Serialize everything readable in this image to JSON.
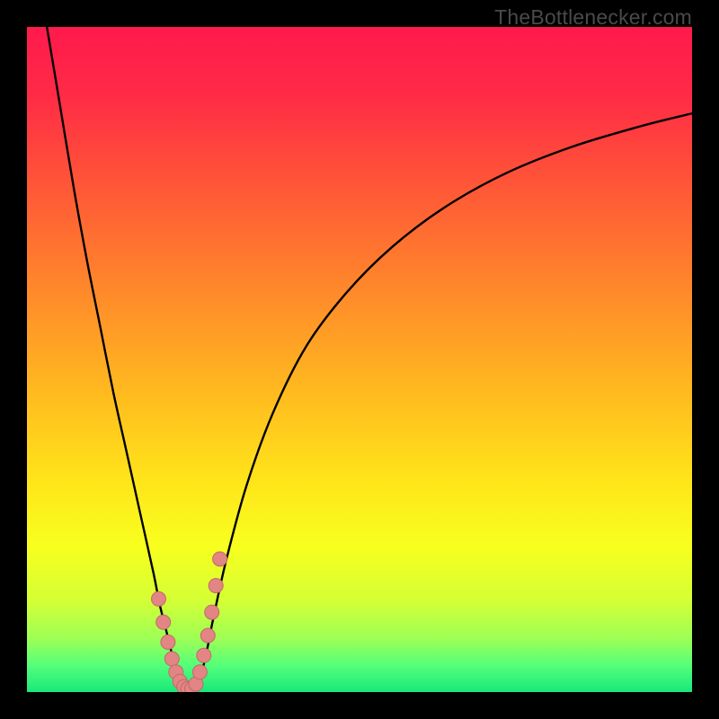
{
  "watermark": "TheBottlenecker.com",
  "gradient": {
    "stops": [
      {
        "offset": 0.0,
        "color": "#ff1a4d"
      },
      {
        "offset": 0.1,
        "color": "#ff2a46"
      },
      {
        "offset": 0.25,
        "color": "#ff5a36"
      },
      {
        "offset": 0.4,
        "color": "#ff8a2a"
      },
      {
        "offset": 0.55,
        "color": "#ffba1f"
      },
      {
        "offset": 0.68,
        "color": "#ffe41a"
      },
      {
        "offset": 0.78,
        "color": "#f8ff1e"
      },
      {
        "offset": 0.86,
        "color": "#d6ff34"
      },
      {
        "offset": 0.92,
        "color": "#9dff55"
      },
      {
        "offset": 0.96,
        "color": "#55ff7a"
      },
      {
        "offset": 1.0,
        "color": "#18e87a"
      }
    ]
  },
  "colors": {
    "curve_stroke": "#000000",
    "marker_fill": "#e38584",
    "marker_stroke": "#c06a69",
    "frame": "#000000"
  },
  "chart_data": {
    "type": "line",
    "title": "",
    "xlabel": "",
    "ylabel": "",
    "xlim": [
      0,
      100
    ],
    "ylim": [
      0,
      100
    ],
    "series": [
      {
        "name": "bottleneck-curve",
        "x": [
          3,
          5,
          7,
          9,
          11,
          13,
          15,
          17,
          19,
          20,
          21,
          22,
          23,
          24,
          25,
          26,
          27,
          28,
          30,
          33,
          37,
          42,
          48,
          55,
          63,
          72,
          82,
          92,
          100
        ],
        "y": [
          100,
          88,
          76,
          65,
          55,
          45,
          36,
          27,
          18,
          13,
          9,
          5,
          2,
          0.5,
          0.5,
          2,
          6,
          11,
          20,
          31,
          42,
          52,
          60,
          67,
          73,
          78,
          82,
          85,
          87
        ]
      }
    ],
    "markers": {
      "name": "highlighted-points",
      "x": [
        19.8,
        20.5,
        21.2,
        21.8,
        22.4,
        23.0,
        23.6,
        24.2,
        24.8,
        25.4,
        26.0,
        26.6,
        27.2,
        27.8,
        28.4,
        29.0
      ],
      "y": [
        14.0,
        10.5,
        7.5,
        5.0,
        3.0,
        1.6,
        0.8,
        0.5,
        0.5,
        1.2,
        3.0,
        5.5,
        8.5,
        12.0,
        16.0,
        20.0
      ]
    },
    "marker_radius_px": 8
  }
}
